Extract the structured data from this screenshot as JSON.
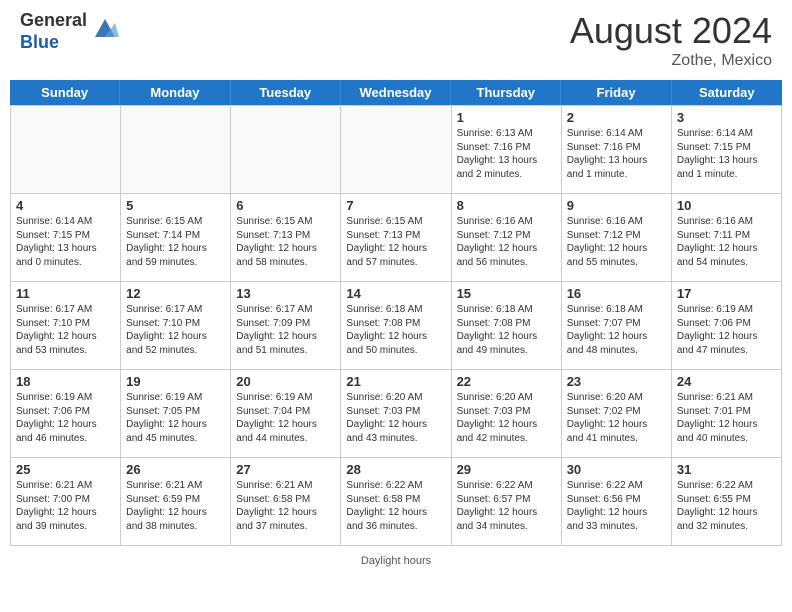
{
  "header": {
    "logo_general": "General",
    "logo_blue": "Blue",
    "month": "August 2024",
    "location": "Zothe, Mexico"
  },
  "days": [
    "Sunday",
    "Monday",
    "Tuesday",
    "Wednesday",
    "Thursday",
    "Friday",
    "Saturday"
  ],
  "footer": {
    "daylight_label": "Daylight hours"
  },
  "weeks": [
    {
      "cells": [
        {
          "empty": true
        },
        {
          "empty": true
        },
        {
          "empty": true
        },
        {
          "empty": true
        },
        {
          "num": "1",
          "line1": "Sunrise: 6:13 AM",
          "line2": "Sunset: 7:16 PM",
          "line3": "Daylight: 13 hours",
          "line4": "and 2 minutes."
        },
        {
          "num": "2",
          "line1": "Sunrise: 6:14 AM",
          "line2": "Sunset: 7:16 PM",
          "line3": "Daylight: 13 hours",
          "line4": "and 1 minute."
        },
        {
          "num": "3",
          "line1": "Sunrise: 6:14 AM",
          "line2": "Sunset: 7:15 PM",
          "line3": "Daylight: 13 hours",
          "line4": "and 1 minute."
        }
      ]
    },
    {
      "cells": [
        {
          "num": "4",
          "line1": "Sunrise: 6:14 AM",
          "line2": "Sunset: 7:15 PM",
          "line3": "Daylight: 13 hours",
          "line4": "and 0 minutes."
        },
        {
          "num": "5",
          "line1": "Sunrise: 6:15 AM",
          "line2": "Sunset: 7:14 PM",
          "line3": "Daylight: 12 hours",
          "line4": "and 59 minutes."
        },
        {
          "num": "6",
          "line1": "Sunrise: 6:15 AM",
          "line2": "Sunset: 7:13 PM",
          "line3": "Daylight: 12 hours",
          "line4": "and 58 minutes."
        },
        {
          "num": "7",
          "line1": "Sunrise: 6:15 AM",
          "line2": "Sunset: 7:13 PM",
          "line3": "Daylight: 12 hours",
          "line4": "and 57 minutes."
        },
        {
          "num": "8",
          "line1": "Sunrise: 6:16 AM",
          "line2": "Sunset: 7:12 PM",
          "line3": "Daylight: 12 hours",
          "line4": "and 56 minutes."
        },
        {
          "num": "9",
          "line1": "Sunrise: 6:16 AM",
          "line2": "Sunset: 7:12 PM",
          "line3": "Daylight: 12 hours",
          "line4": "and 55 minutes."
        },
        {
          "num": "10",
          "line1": "Sunrise: 6:16 AM",
          "line2": "Sunset: 7:11 PM",
          "line3": "Daylight: 12 hours",
          "line4": "and 54 minutes."
        }
      ]
    },
    {
      "cells": [
        {
          "num": "11",
          "line1": "Sunrise: 6:17 AM",
          "line2": "Sunset: 7:10 PM",
          "line3": "Daylight: 12 hours",
          "line4": "and 53 minutes."
        },
        {
          "num": "12",
          "line1": "Sunrise: 6:17 AM",
          "line2": "Sunset: 7:10 PM",
          "line3": "Daylight: 12 hours",
          "line4": "and 52 minutes."
        },
        {
          "num": "13",
          "line1": "Sunrise: 6:17 AM",
          "line2": "Sunset: 7:09 PM",
          "line3": "Daylight: 12 hours",
          "line4": "and 51 minutes."
        },
        {
          "num": "14",
          "line1": "Sunrise: 6:18 AM",
          "line2": "Sunset: 7:08 PM",
          "line3": "Daylight: 12 hours",
          "line4": "and 50 minutes."
        },
        {
          "num": "15",
          "line1": "Sunrise: 6:18 AM",
          "line2": "Sunset: 7:08 PM",
          "line3": "Daylight: 12 hours",
          "line4": "and 49 minutes."
        },
        {
          "num": "16",
          "line1": "Sunrise: 6:18 AM",
          "line2": "Sunset: 7:07 PM",
          "line3": "Daylight: 12 hours",
          "line4": "and 48 minutes."
        },
        {
          "num": "17",
          "line1": "Sunrise: 6:19 AM",
          "line2": "Sunset: 7:06 PM",
          "line3": "Daylight: 12 hours",
          "line4": "and 47 minutes."
        }
      ]
    },
    {
      "cells": [
        {
          "num": "18",
          "line1": "Sunrise: 6:19 AM",
          "line2": "Sunset: 7:06 PM",
          "line3": "Daylight: 12 hours",
          "line4": "and 46 minutes."
        },
        {
          "num": "19",
          "line1": "Sunrise: 6:19 AM",
          "line2": "Sunset: 7:05 PM",
          "line3": "Daylight: 12 hours",
          "line4": "and 45 minutes."
        },
        {
          "num": "20",
          "line1": "Sunrise: 6:19 AM",
          "line2": "Sunset: 7:04 PM",
          "line3": "Daylight: 12 hours",
          "line4": "and 44 minutes."
        },
        {
          "num": "21",
          "line1": "Sunrise: 6:20 AM",
          "line2": "Sunset: 7:03 PM",
          "line3": "Daylight: 12 hours",
          "line4": "and 43 minutes."
        },
        {
          "num": "22",
          "line1": "Sunrise: 6:20 AM",
          "line2": "Sunset: 7:03 PM",
          "line3": "Daylight: 12 hours",
          "line4": "and 42 minutes."
        },
        {
          "num": "23",
          "line1": "Sunrise: 6:20 AM",
          "line2": "Sunset: 7:02 PM",
          "line3": "Daylight: 12 hours",
          "line4": "and 41 minutes."
        },
        {
          "num": "24",
          "line1": "Sunrise: 6:21 AM",
          "line2": "Sunset: 7:01 PM",
          "line3": "Daylight: 12 hours",
          "line4": "and 40 minutes."
        }
      ]
    },
    {
      "cells": [
        {
          "num": "25",
          "line1": "Sunrise: 6:21 AM",
          "line2": "Sunset: 7:00 PM",
          "line3": "Daylight: 12 hours",
          "line4": "and 39 minutes."
        },
        {
          "num": "26",
          "line1": "Sunrise: 6:21 AM",
          "line2": "Sunset: 6:59 PM",
          "line3": "Daylight: 12 hours",
          "line4": "and 38 minutes."
        },
        {
          "num": "27",
          "line1": "Sunrise: 6:21 AM",
          "line2": "Sunset: 6:58 PM",
          "line3": "Daylight: 12 hours",
          "line4": "and 37 minutes."
        },
        {
          "num": "28",
          "line1": "Sunrise: 6:22 AM",
          "line2": "Sunset: 6:58 PM",
          "line3": "Daylight: 12 hours",
          "line4": "and 36 minutes."
        },
        {
          "num": "29",
          "line1": "Sunrise: 6:22 AM",
          "line2": "Sunset: 6:57 PM",
          "line3": "Daylight: 12 hours",
          "line4": "and 34 minutes."
        },
        {
          "num": "30",
          "line1": "Sunrise: 6:22 AM",
          "line2": "Sunset: 6:56 PM",
          "line3": "Daylight: 12 hours",
          "line4": "and 33 minutes."
        },
        {
          "num": "31",
          "line1": "Sunrise: 6:22 AM",
          "line2": "Sunset: 6:55 PM",
          "line3": "Daylight: 12 hours",
          "line4": "and 32 minutes."
        }
      ]
    }
  ]
}
